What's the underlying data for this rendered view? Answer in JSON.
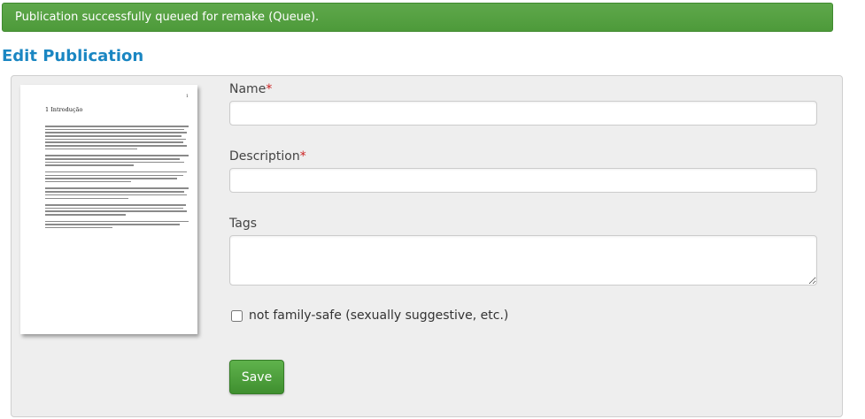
{
  "alert": {
    "message": "Publication successfully queued for remake (Queue)."
  },
  "page": {
    "title": "Edit Publication"
  },
  "preview": {
    "page_number": "1",
    "chapter_heading": "1  Introdução",
    "paragraph_line_counts": [
      8,
      4,
      4,
      4,
      4,
      3
    ]
  },
  "form": {
    "name": {
      "label": "Name",
      "required_mark": "*",
      "value": ""
    },
    "description": {
      "label": "Description",
      "required_mark": "*",
      "value": ""
    },
    "tags": {
      "label": "Tags",
      "value": ""
    },
    "family_safe": {
      "label": "not family-safe (sexually suggestive, etc.)",
      "checked": false
    },
    "save_label": "Save"
  },
  "colors": {
    "alert_bg": "#5fa84b",
    "title_blue": "#1a86c2",
    "required_red": "#cc2222",
    "save_green": "#4a9c38"
  }
}
